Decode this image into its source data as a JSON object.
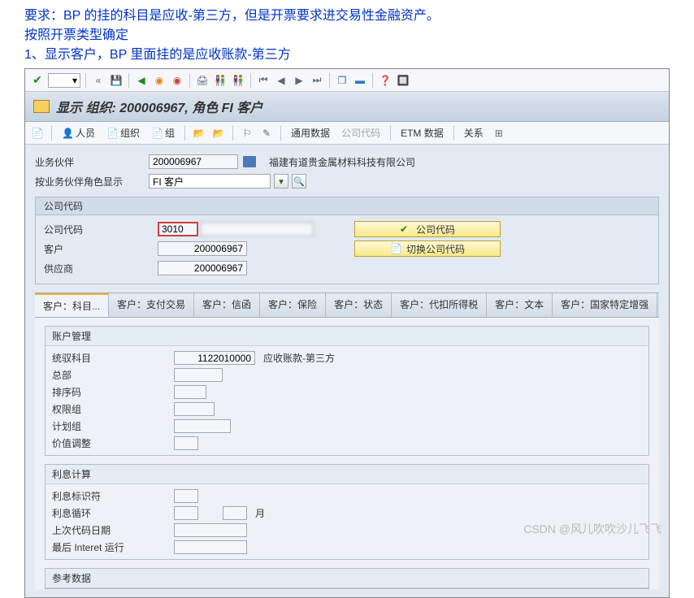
{
  "notes": {
    "line1": "要求：BP 的挂的科目是应收-第三方，但是开票要求进交易性金融资产。",
    "line2": " 按照开票类型确定",
    "line3": "1、显示客户，BP 里面挂的是应收账款-第三方"
  },
  "title": "显示 组织: 200006967, 角色 FI 客户",
  "toolbar2": {
    "person": "人员",
    "org": "组织",
    "group": "组",
    "general": "通用数据",
    "company": "公司代码",
    "etm": "ETM 数据",
    "relation": "关系"
  },
  "header": {
    "partner_label": "业务伙伴",
    "partner_value": "200006967",
    "partner_name": "福建有道贵金属材料科技有限公司",
    "role_label": "按业务伙伴角色显示",
    "role_value": "FI 客户"
  },
  "company": {
    "legend": "公司代码",
    "code_label": "公司代码",
    "code_value": "3010",
    "customer_label": "客户",
    "customer_value": "200006967",
    "vendor_label": "供应商",
    "vendor_value": "200006967",
    "btn_company": "公司代码",
    "btn_switch": "切换公司代码"
  },
  "tabs": {
    "t1": "客户：科目...",
    "t2": "客户：支付交易",
    "t3": "客户：信函",
    "t4": "客户：保险",
    "t5": "客户：状态",
    "t6": "客户：代扣所得税",
    "t7": "客户：文本",
    "t8": "客户：国家特定增强"
  },
  "acct_mgmt": {
    "legend": "账户管理",
    "recon_label": "统驭科目",
    "recon_value": "1122010000",
    "recon_text": "应收账款-第三方",
    "hq_label": "总部",
    "sort_label": "排序码",
    "auth_label": "权限组",
    "plan_label": "计划组",
    "valadj_label": "价值调整"
  },
  "interest": {
    "legend": "利息计算",
    "indicator_label": "利息标识符",
    "cycle_label": "利息循环",
    "month": "月",
    "lastdate_label": "上次代码日期",
    "lastrun_label": "最后 Interet 运行"
  },
  "refdata_legend": "参考数据",
  "watermark": "CSDN @风儿吹吹沙儿飞飞"
}
